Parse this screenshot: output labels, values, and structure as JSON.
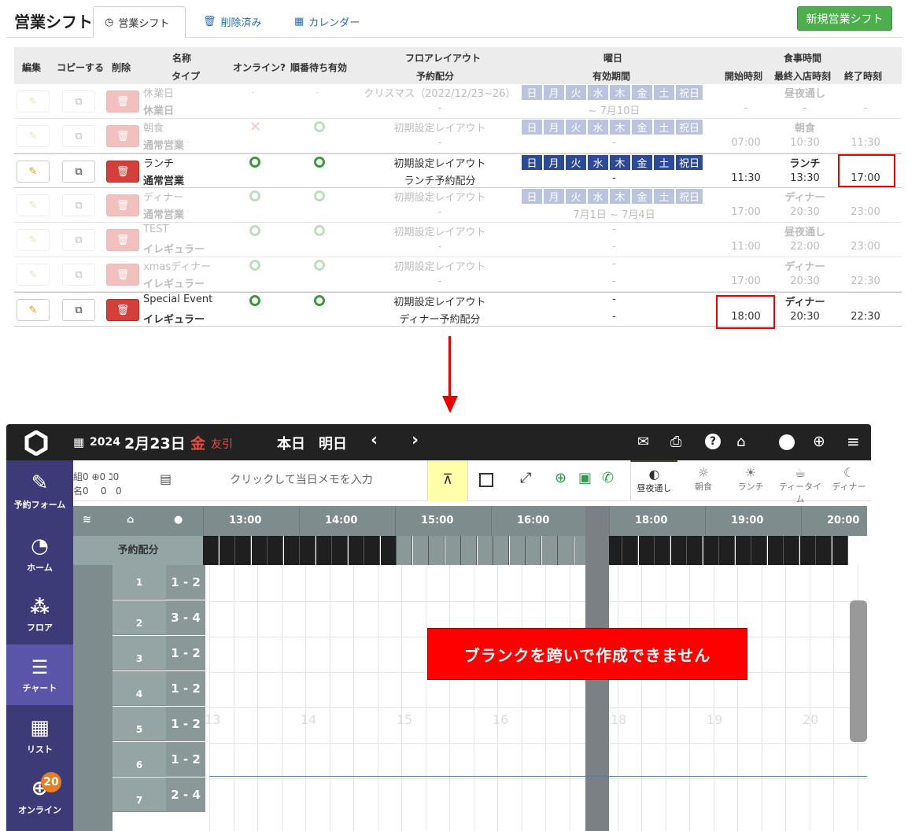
{
  "top": {
    "title": "営業シフト",
    "tabs": [
      "営業シフト",
      "削除済み",
      "カレンダー"
    ],
    "new_button": "新規営業シフト",
    "headers": {
      "edit": "編集",
      "copy": "コピーする",
      "delete": "削除",
      "name": "名称",
      "type": "タイプ",
      "online": "オンライン?",
      "queue": "順番待ち有効",
      "layout": "フロアレイアウト",
      "alloc": "予約配分",
      "weekday": "曜日",
      "period": "有効期間",
      "meal": "食事時間",
      "start": "開始時刻",
      "last": "最終入店時刻",
      "end": "終了時刻"
    },
    "rows": [
      {
        "name": "休業日",
        "type": "休業日",
        "online": "-",
        "queue": "-",
        "layout": "クリスマス（2022/12/23~26）",
        "alloc": "-",
        "days": [
          "日",
          "月",
          "火",
          "水",
          "木",
          "金",
          "土",
          "祝日"
        ],
        "period": "~ 7月10日",
        "meal": "昼夜通し",
        "start": "-",
        "last": "-",
        "end": "-"
      },
      {
        "name": "朝食",
        "type": "通常営業",
        "online": "✕",
        "queue": "○",
        "layout": "初期設定レイアウト",
        "alloc": "-",
        "days": [
          "日",
          "月",
          "火",
          "水",
          "木",
          "金",
          "土",
          "祝日"
        ],
        "period": "-",
        "meal": "朝食",
        "start": "07:00",
        "last": "10:30",
        "end": "11:30"
      },
      {
        "name": "ランチ",
        "type": "通常営業",
        "online": "○",
        "queue": "○",
        "layout": "初期設定レイアウト",
        "alloc": "ランチ予約配分",
        "days": [
          "日",
          "月",
          "火",
          "水",
          "木",
          "金",
          "土",
          "祝日"
        ],
        "period": "-",
        "meal": "ランチ",
        "start": "11:30",
        "last": "13:30",
        "end": "17:00"
      },
      {
        "name": "ディナー",
        "type": "通常営業",
        "online": "○",
        "queue": "○",
        "layout": "初期設定レイアウト",
        "alloc": "-",
        "days": [
          "日",
          "月",
          "火",
          "水",
          "木",
          "金",
          "土",
          "祝日"
        ],
        "period": "7月1日 ~ 7月4日",
        "meal": "ディナー",
        "start": "17:00",
        "last": "20:30",
        "end": "23:00"
      },
      {
        "name": "TEST",
        "type": "イレギュラー",
        "online": "○",
        "queue": "○",
        "layout": "初期設定レイアウト",
        "alloc": "-",
        "days": [],
        "period": "-",
        "meal": "昼夜通し",
        "start": "11:00",
        "last": "22:00",
        "end": "23:00"
      },
      {
        "name": "xmasディナー",
        "type": "イレギュラー",
        "online": "○",
        "queue": "○",
        "layout": "初期設定レイアウト",
        "alloc": "-",
        "days": [],
        "period": "-",
        "meal": "ディナー",
        "start": "17:00",
        "last": "20:30",
        "end": "22:30"
      },
      {
        "name": "Special Event",
        "type": "イレギュラー",
        "online": "○",
        "queue": "○",
        "layout": "初期設定レイアウト",
        "alloc": "ディナー予約配分",
        "days": [],
        "period": "-",
        "meal": "ディナー",
        "start": "18:00",
        "last": "20:30",
        "end": "22:30"
      }
    ]
  },
  "app": {
    "year": "2024",
    "date": "2月23日",
    "dow": "金",
    "rokuyo": "友引",
    "today": "本日",
    "tomorrow": "明日",
    "counts": {
      "kumi_label": "組",
      "kumi": "0",
      "online": "0",
      "walk": "0",
      "mei_label": "名",
      "mei": "0",
      "online2": "0",
      "walk2": "0"
    },
    "memo_placeholder": "クリックして当日メモを入力",
    "shifts": [
      "昼夜通し",
      "朝食",
      "ランチ",
      "ティータイム",
      "ディナー"
    ],
    "sidebar": [
      "予約フォーム",
      "ホーム",
      "フロア",
      "チャート",
      "リスト",
      "オンライン"
    ],
    "online_badge": "20",
    "times": [
      "13:00",
      "14:00",
      "15:00",
      "16:00",
      "18:00",
      "19:00",
      "20:00"
    ],
    "alloc_label": "予約配分",
    "tables": [
      {
        "no": "1",
        "cap": "1 - 2"
      },
      {
        "no": "2",
        "cap": "3 - 4"
      },
      {
        "no": "3",
        "cap": "1 - 2"
      },
      {
        "no": "4",
        "cap": "1 - 2"
      },
      {
        "no": "5",
        "cap": "1 - 2"
      },
      {
        "no": "6",
        "cap": "1 - 2"
      },
      {
        "no": "7",
        "cap": "2 - 4"
      }
    ],
    "grid_hours": [
      "13",
      "14",
      "15",
      "16",
      "18",
      "19",
      "20"
    ],
    "message": "ブランクを跨いで作成できません"
  },
  "colors": {
    "accent_red": "#ff0000",
    "sidebar": "#3d3a78",
    "day_blue": "#2c4a9a",
    "green": "#4cae4c"
  }
}
